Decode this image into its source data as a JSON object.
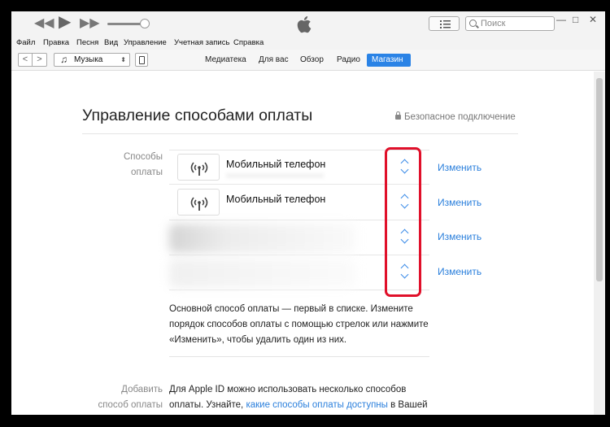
{
  "titlebar": {
    "search_placeholder": "Поиск",
    "window_controls": [
      "—",
      "□",
      "✕"
    ]
  },
  "menu": [
    "Файл",
    "Правка",
    "Песня",
    "Вид",
    "Управление",
    "Учетная запись",
    "Справка"
  ],
  "toolbar": {
    "back": "<",
    "forward": ">",
    "library": "Музыка",
    "tabs": [
      {
        "label": "Медиатека",
        "active": false
      },
      {
        "label": "Для вас",
        "active": false
      },
      {
        "label": "Обзор",
        "active": false
      },
      {
        "label": "Радио",
        "active": false
      },
      {
        "label": "Магазин",
        "active": true
      }
    ]
  },
  "page": {
    "title": "Управление способами оплаты",
    "secure": "Безопасное подключение",
    "methods_label": "Способы оплаты",
    "methods": [
      {
        "name": "Мобильный телефон",
        "change": "Изменить"
      },
      {
        "name": "Мобильный телефон",
        "change": "Изменить"
      },
      {
        "name": "",
        "change": "Изменить"
      },
      {
        "name": "",
        "change": "Изменить"
      }
    ],
    "note": "Основной способ оплаты — первый в списке. Измените порядок способов оплаты с помощью стрелок или нажмите «Изменить», чтобы удалить один из них.",
    "add_label": "Добавить способ оплаты",
    "add_text_before": "Для Apple ID можно использовать несколько способов оплаты. Узнайте, ",
    "add_link": "какие способы оплаты доступны",
    "add_text_after": " в Вашей стране или регионе. Если для оплаты покупки"
  },
  "colors": {
    "accent": "#2a83e6",
    "highlight": "#e0102a"
  }
}
